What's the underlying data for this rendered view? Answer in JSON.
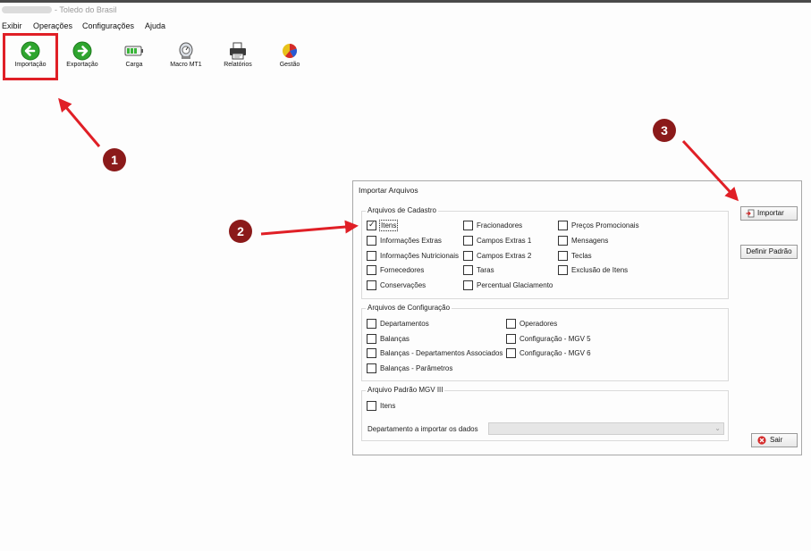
{
  "window": {
    "title": "- Toledo do Brasil"
  },
  "menubar": {
    "items": [
      "Exibir",
      "Operações",
      "Configurações",
      "Ajuda"
    ]
  },
  "toolbar": {
    "buttons": [
      {
        "label": "Importação",
        "icon": "green-arrow-left-icon"
      },
      {
        "label": "Exportação",
        "icon": "green-arrow-right-icon"
      },
      {
        "label": "Carga",
        "icon": "battery-icon"
      },
      {
        "label": "Macro MT1",
        "icon": "scale-icon"
      },
      {
        "label": "Relatórios",
        "icon": "printer-icon"
      },
      {
        "label": "Gestão",
        "icon": "pie-chart-icon"
      }
    ]
  },
  "annotations": {
    "badges": [
      "1",
      "2",
      "3"
    ],
    "color": "#e01f26",
    "badge_color": "#8b1a1a"
  },
  "dialog": {
    "title": "Importar Arquivos",
    "cadastro": {
      "title": "Arquivos de Cadastro",
      "items": [
        {
          "label": "Itens",
          "checked": true
        },
        {
          "label": "Informações Extras",
          "checked": false
        },
        {
          "label": "Informações Nutricionais",
          "checked": false
        },
        {
          "label": "Fornecedores",
          "checked": false
        },
        {
          "label": "Conservações",
          "checked": false
        },
        {
          "label": "Fracionadores",
          "checked": false
        },
        {
          "label": "Campos Extras 1",
          "checked": false
        },
        {
          "label": "Campos Extras 2",
          "checked": false
        },
        {
          "label": "Taras",
          "checked": false
        },
        {
          "label": "Percentual Glaciamento",
          "checked": false
        },
        {
          "label": "Preços Promocionais",
          "checked": false
        },
        {
          "label": "Mensagens",
          "checked": false
        },
        {
          "label": "Teclas",
          "checked": false
        },
        {
          "label": "Exclusão de Itens",
          "checked": false
        }
      ]
    },
    "configuracao": {
      "title": "Arquivos de Configuração",
      "items": [
        {
          "label": "Departamentos",
          "checked": false
        },
        {
          "label": "Balanças",
          "checked": false
        },
        {
          "label": "Balanças - Departamentos Associados",
          "checked": false
        },
        {
          "label": "Balanças - Parâmetros",
          "checked": false
        },
        {
          "label": "Operadores",
          "checked": false
        },
        {
          "label": "Configuração - MGV 5",
          "checked": false
        },
        {
          "label": "Configuração - MGV 6",
          "checked": false
        }
      ]
    },
    "mgv3": {
      "title": "Arquivo Padrão MGV III",
      "items": [
        {
          "label": "Itens",
          "checked": false
        }
      ],
      "dept_label": "Departamento a importar os dados",
      "dept_value": ""
    },
    "buttons": {
      "importar": "Importar",
      "definir_padrao": "Definir Padrão",
      "sair": "Sair"
    }
  }
}
